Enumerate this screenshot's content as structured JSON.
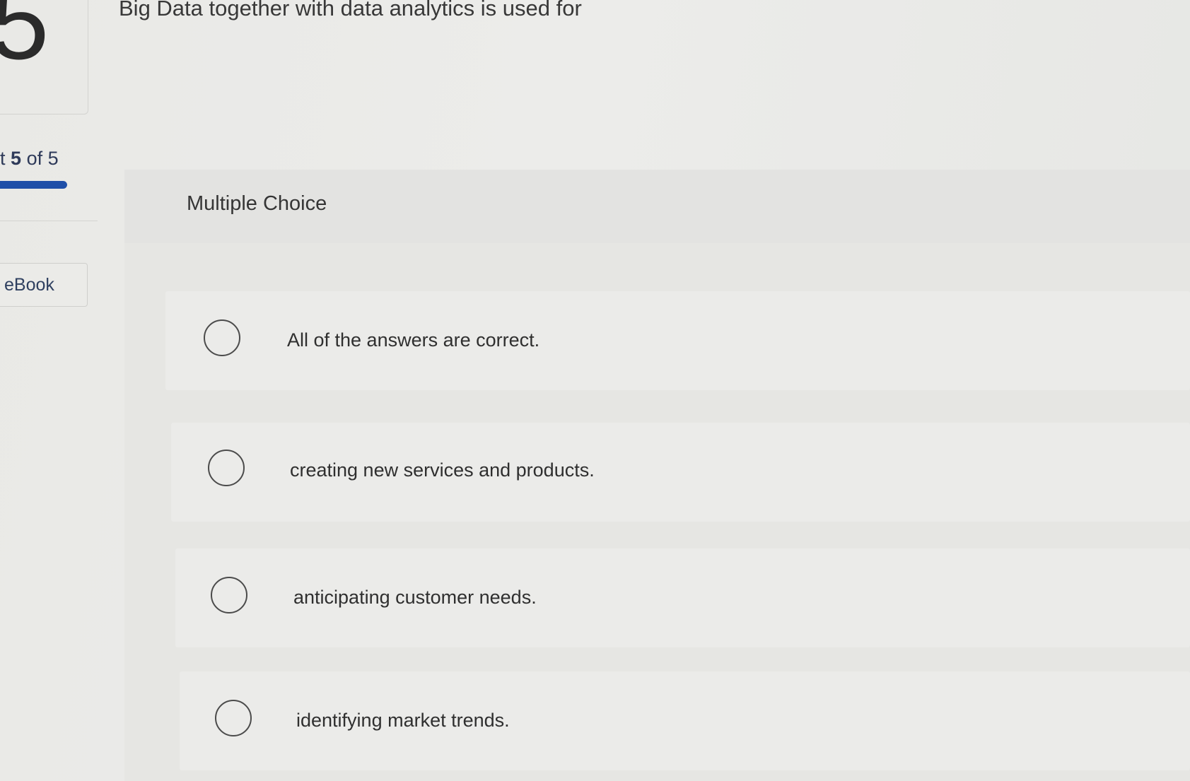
{
  "question": {
    "number": "5",
    "text": "Big Data together with data analytics is used for"
  },
  "progress": {
    "prefix": "t",
    "current": "5",
    "separator": "of",
    "total": "5",
    "fill_fraction": 1.0,
    "bar_color": "#1f4fa8"
  },
  "sidebar": {
    "ebook_label": "eBook"
  },
  "question_type": "Multiple Choice",
  "answers": [
    {
      "label": "All of the answers are correct.",
      "selected": false
    },
    {
      "label": "creating new services and products.",
      "selected": false
    },
    {
      "label": "anticipating customer needs.",
      "selected": false
    },
    {
      "label": "identifying market trends.",
      "selected": false
    }
  ]
}
